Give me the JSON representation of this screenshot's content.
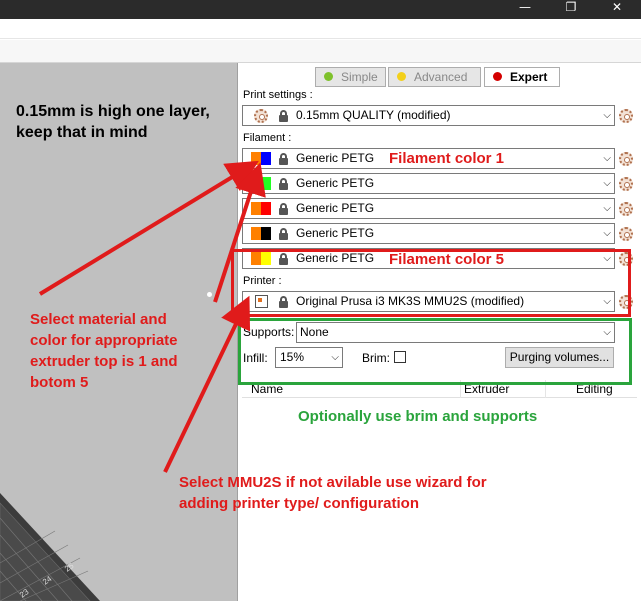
{
  "window": {
    "minimize_glyph": "—",
    "restore_glyph": "❐",
    "close_glyph": "✕"
  },
  "modes": {
    "simple": {
      "label": "Simple",
      "color": "#7ec12b"
    },
    "advanced": {
      "label": "Advanced",
      "color": "#f3d01a"
    },
    "expert": {
      "label": "Expert",
      "color": "#d40000"
    }
  },
  "print_settings": {
    "label": "Print settings :",
    "value": "0.15mm QUALITY (modified)"
  },
  "filament": {
    "label": "Filament :",
    "items": [
      {
        "name": "Generic PETG",
        "colors": [
          "#ff8000",
          "#0000ff"
        ]
      },
      {
        "name": "Generic PETG",
        "colors": [
          "#ff8000",
          "#22ff22"
        ]
      },
      {
        "name": "Generic PETG",
        "colors": [
          "#ff8000",
          "#ff0000"
        ]
      },
      {
        "name": "Generic PETG",
        "colors": [
          "#ff8000",
          "#000000"
        ]
      },
      {
        "name": "Generic PETG",
        "colors": [
          "#ff8000",
          "#ffff00"
        ]
      }
    ]
  },
  "printer": {
    "label": "Printer :",
    "value": "Original Prusa i3 MK3S MMU2S (modified)"
  },
  "supports": {
    "label": "Supports:",
    "value": "None"
  },
  "infill": {
    "label": "Infill:",
    "value": "15%"
  },
  "brim": {
    "label": "Brim:"
  },
  "purging_button": {
    "label": "Purging volumes..."
  },
  "object_list": {
    "columns": [
      "Name",
      "Extruder",
      "Editing"
    ]
  },
  "bed": {
    "tick_labels": [
      "23",
      "24",
      "25"
    ]
  },
  "annotations": {
    "layer_note": "0.15mm is high one layer,\nkeep that in mind",
    "filament_color_1": "Filament color 1",
    "filament_color_5": "Filament color 5",
    "select_material": "Select material and\ncolor for appropriate\nextruder top is 1 and\nbotom 5",
    "brim_supports": "Optionally use brim and supports",
    "select_mmu": "Select MMU2S if not avilable use wizard for\nadding printer type/ configuration",
    "red": "#e01b1b",
    "green": "#2aa43c"
  }
}
